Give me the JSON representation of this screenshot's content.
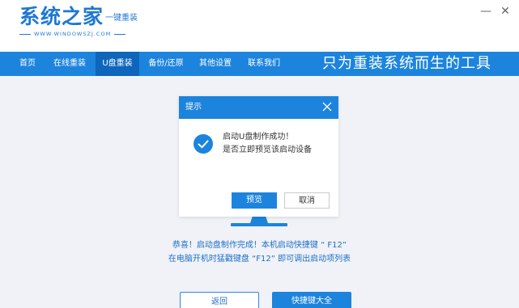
{
  "header": {
    "logo_title": "系统之家",
    "logo_tag": "一键重装",
    "logo_url": "WWW.WINDOWSZJ.COM",
    "minimize_label": "—",
    "close_label": "✕"
  },
  "nav": {
    "items": [
      {
        "label": "首页"
      },
      {
        "label": "在线重装"
      },
      {
        "label": "U盘重装"
      },
      {
        "label": "备份/还原"
      },
      {
        "label": "其他设置"
      },
      {
        "label": "联系我们"
      }
    ],
    "active_index": 2,
    "slogan": "只为重装系统而生的工具"
  },
  "main": {
    "message_line1": "恭喜！启动盘制作完成！本机启动快捷键 “ F12”",
    "message_line2": "在电脑开机时猛戳键盘 “F12” 即可调出启动项列表",
    "back_button": "返回",
    "hotkey_button": "快捷键大全"
  },
  "dialog": {
    "title": "提示",
    "line1": "启动U盘制作成功！",
    "line2": "是否立即预览该启动设备",
    "preview_button": "预览",
    "cancel_button": "取消"
  },
  "colors": {
    "brand_blue": "#1c84dd",
    "nav_active": "#0d66bb",
    "background": "#f0f2f7"
  },
  "icons": {
    "dialog_check": "check-circle-icon",
    "dialog_close": "close-icon",
    "monitor": "monitor-stand-icon"
  }
}
